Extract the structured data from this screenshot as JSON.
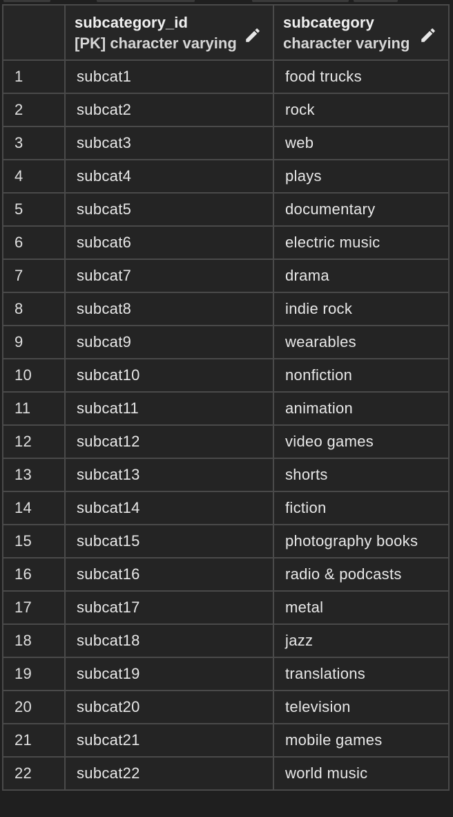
{
  "columns": [
    {
      "name": "subcategory_id",
      "type": "[PK] character varying",
      "icon": "pencil-icon"
    },
    {
      "name": "subcategory",
      "type": "character varying",
      "icon": "pencil-icon"
    }
  ],
  "rows": [
    {
      "num": "1",
      "subcategory_id": "subcat1",
      "subcategory": "food trucks"
    },
    {
      "num": "2",
      "subcategory_id": "subcat2",
      "subcategory": "rock"
    },
    {
      "num": "3",
      "subcategory_id": "subcat3",
      "subcategory": "web"
    },
    {
      "num": "4",
      "subcategory_id": "subcat4",
      "subcategory": "plays"
    },
    {
      "num": "5",
      "subcategory_id": "subcat5",
      "subcategory": "documentary"
    },
    {
      "num": "6",
      "subcategory_id": "subcat6",
      "subcategory": "electric music"
    },
    {
      "num": "7",
      "subcategory_id": "subcat7",
      "subcategory": "drama"
    },
    {
      "num": "8",
      "subcategory_id": "subcat8",
      "subcategory": "indie rock"
    },
    {
      "num": "9",
      "subcategory_id": "subcat9",
      "subcategory": "wearables"
    },
    {
      "num": "10",
      "subcategory_id": "subcat10",
      "subcategory": "nonfiction"
    },
    {
      "num": "11",
      "subcategory_id": "subcat11",
      "subcategory": "animation"
    },
    {
      "num": "12",
      "subcategory_id": "subcat12",
      "subcategory": "video games"
    },
    {
      "num": "13",
      "subcategory_id": "subcat13",
      "subcategory": "shorts"
    },
    {
      "num": "14",
      "subcategory_id": "subcat14",
      "subcategory": "fiction"
    },
    {
      "num": "15",
      "subcategory_id": "subcat15",
      "subcategory": "photography books"
    },
    {
      "num": "16",
      "subcategory_id": "subcat16",
      "subcategory": "radio & podcasts"
    },
    {
      "num": "17",
      "subcategory_id": "subcat17",
      "subcategory": "metal"
    },
    {
      "num": "18",
      "subcategory_id": "subcat18",
      "subcategory": "jazz"
    },
    {
      "num": "19",
      "subcategory_id": "subcat19",
      "subcategory": "translations"
    },
    {
      "num": "20",
      "subcategory_id": "subcat20",
      "subcategory": "television"
    },
    {
      "num": "21",
      "subcategory_id": "subcat21",
      "subcategory": "mobile games"
    },
    {
      "num": "22",
      "subcategory_id": "subcat22",
      "subcategory": "world music"
    }
  ],
  "colors": {
    "background": "#1f1f1f",
    "cell": "#242424",
    "border": "#4a4a4a",
    "text": "#e8e8e8"
  }
}
